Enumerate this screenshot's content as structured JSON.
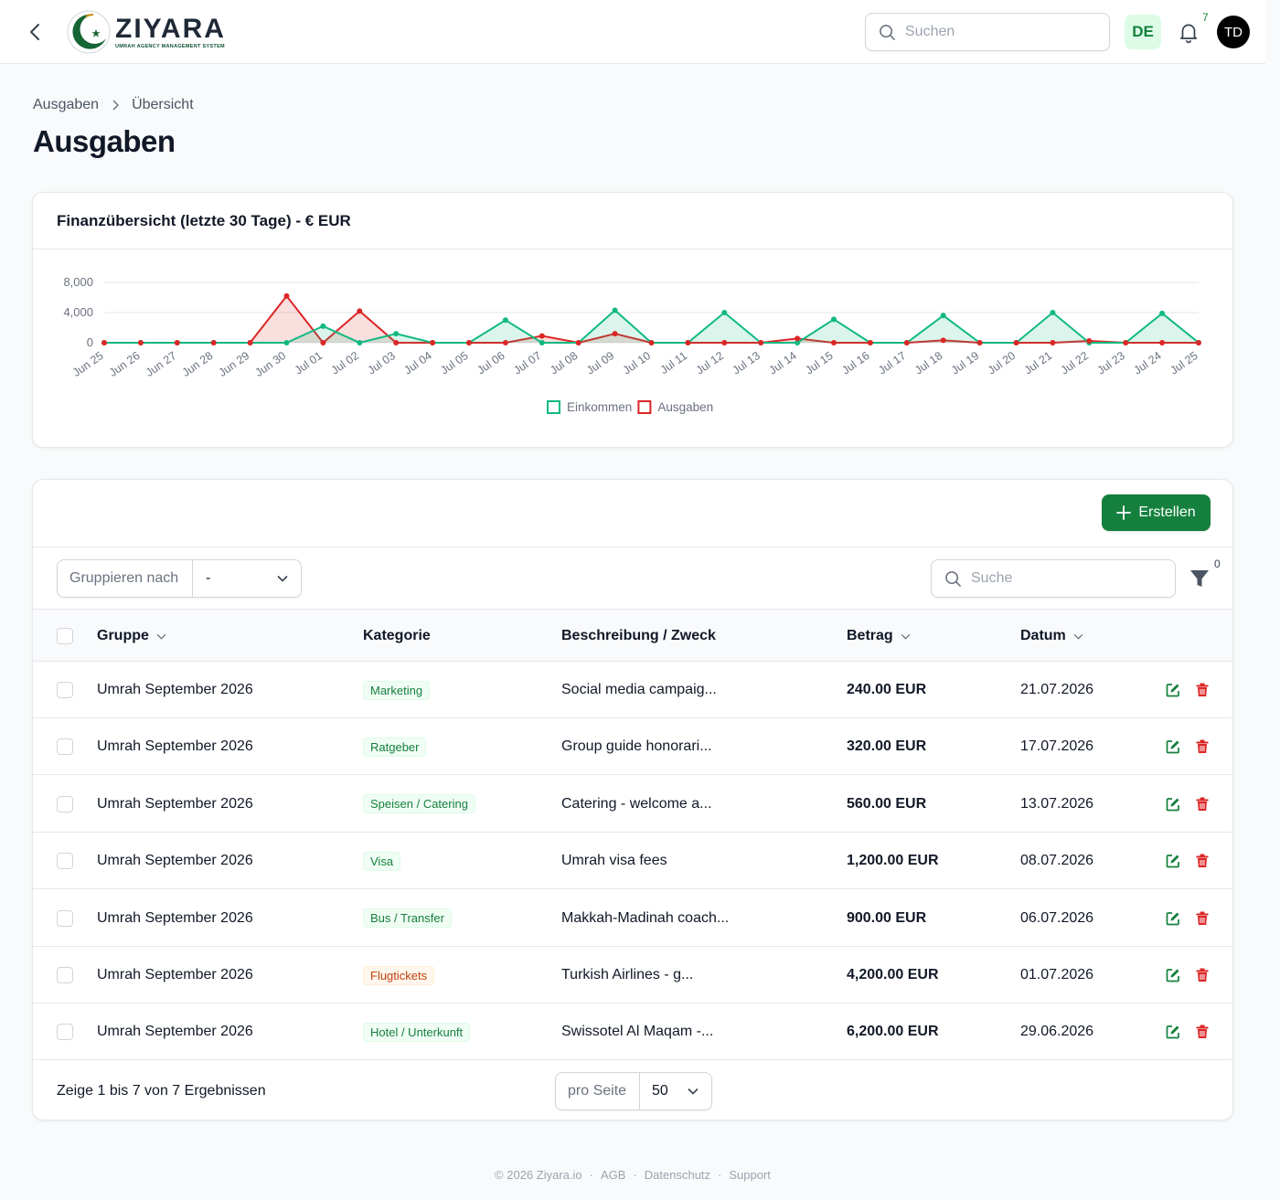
{
  "header": {
    "logo_name": "ZIYARA",
    "logo_tagline": "UMRAH AGENCY MANAGEMENT SYSTEM",
    "search_placeholder": "Suchen",
    "language": "DE",
    "notification_count": "7",
    "avatar_initials": "TD"
  },
  "breadcrumb": {
    "items": [
      "Ausgaben",
      "Übersicht"
    ]
  },
  "page_title": "Ausgaben",
  "chart_card_title": "Finanzübersicht (letzte 30 Tage) - € EUR",
  "chart_data": {
    "type": "area",
    "title": "Finanzübersicht (letzte 30 Tage) - € EUR",
    "categories": [
      "Jun 25",
      "Jun 26",
      "Jun 27",
      "Jun 28",
      "Jun 29",
      "Jun 30",
      "Jul 01",
      "Jul 02",
      "Jul 03",
      "Jul 04",
      "Jul 05",
      "Jul 06",
      "Jul 07",
      "Jul 08",
      "Jul 09",
      "Jul 10",
      "Jul 11",
      "Jul 12",
      "Jul 13",
      "Jul 14",
      "Jul 15",
      "Jul 16",
      "Jul 17",
      "Jul 18",
      "Jul 19",
      "Jul 20",
      "Jul 21",
      "Jul 22",
      "Jul 23",
      "Jul 24",
      "Jul 25"
    ],
    "y_ticks": [
      "8,000",
      "4,000",
      "0"
    ],
    "ylim": [
      0,
      8000
    ],
    "grid": true,
    "legend_position": "bottom-center",
    "series": [
      {
        "name": "Einkommen",
        "color": "#10b981",
        "values": [
          0,
          0,
          0,
          0,
          0,
          0,
          2200,
          0,
          1200,
          0,
          0,
          3000,
          0,
          0,
          4300,
          0,
          0,
          4000,
          0,
          0,
          3100,
          0,
          0,
          3600,
          0,
          0,
          4000,
          0,
          0,
          3900,
          0
        ]
      },
      {
        "name": "Ausgaben",
        "color": "#dc2626",
        "values": [
          0,
          0,
          0,
          0,
          0,
          6200,
          0,
          4200,
          0,
          0,
          0,
          0,
          900,
          0,
          1200,
          0,
          0,
          0,
          0,
          560,
          0,
          0,
          0,
          320,
          0,
          0,
          0,
          240,
          0,
          0,
          0
        ]
      }
    ]
  },
  "table": {
    "create_label": "Erstellen",
    "group_by_label": "Gruppieren nach",
    "group_by_value": "-",
    "search_placeholder": "Suche",
    "filter_count": "0",
    "columns": {
      "group": "Gruppe",
      "category": "Kategorie",
      "description": "Beschreibung / Zweck",
      "amount": "Betrag",
      "date": "Datum"
    },
    "rows": [
      {
        "group": "Umrah September 2026",
        "category": "Marketing",
        "description": "Social media campaig...",
        "amount": "240.00 EUR",
        "date": "21.07.2026"
      },
      {
        "group": "Umrah September 2026",
        "category": "Ratgeber",
        "description": "Group guide honorari...",
        "amount": "320.00 EUR",
        "date": "17.07.2026"
      },
      {
        "group": "Umrah September 2026",
        "category": "Speisen / Catering",
        "description": "Catering - welcome a...",
        "amount": "560.00 EUR",
        "date": "13.07.2026"
      },
      {
        "group": "Umrah September 2026",
        "category": "Visa",
        "description": "Umrah visa fees",
        "amount": "1,200.00 EUR",
        "date": "08.07.2026"
      },
      {
        "group": "Umrah September 2026",
        "category": "Bus / Transfer",
        "description": "Makkah-Madinah coach...",
        "amount": "900.00 EUR",
        "date": "06.07.2026"
      },
      {
        "group": "Umrah September 2026",
        "category": "Flugtickets",
        "description": "Turkish Airlines - g...",
        "amount": "4,200.00 EUR",
        "date": "01.07.2026"
      },
      {
        "group": "Umrah September 2026",
        "category": "Hotel / Unterkunft",
        "description": "Swissotel Al Maqam -...",
        "amount": "6,200.00 EUR",
        "date": "29.06.2026"
      }
    ],
    "footer_text": "Zeige 1 bis 7 von 7 Ergebnissen",
    "per_page_label": "pro Seite",
    "per_page_value": "50"
  },
  "footer": {
    "copyright": "© 2026 Ziyara.io",
    "links": [
      "AGB",
      "Datenschutz",
      "Support"
    ]
  },
  "colors": {
    "brand_green": "#15803d",
    "income": "#10b981",
    "expense": "#dc2626",
    "delete": "#dc2626",
    "category_orange": "#c2410c"
  },
  "icons": {
    "back": "chevron-left-icon",
    "search": "search-icon",
    "bell": "bell-icon",
    "plus": "plus-icon",
    "filter": "funnel-icon",
    "edit": "edit-icon",
    "delete": "trash-icon",
    "sort": "chevron-down-icon"
  }
}
